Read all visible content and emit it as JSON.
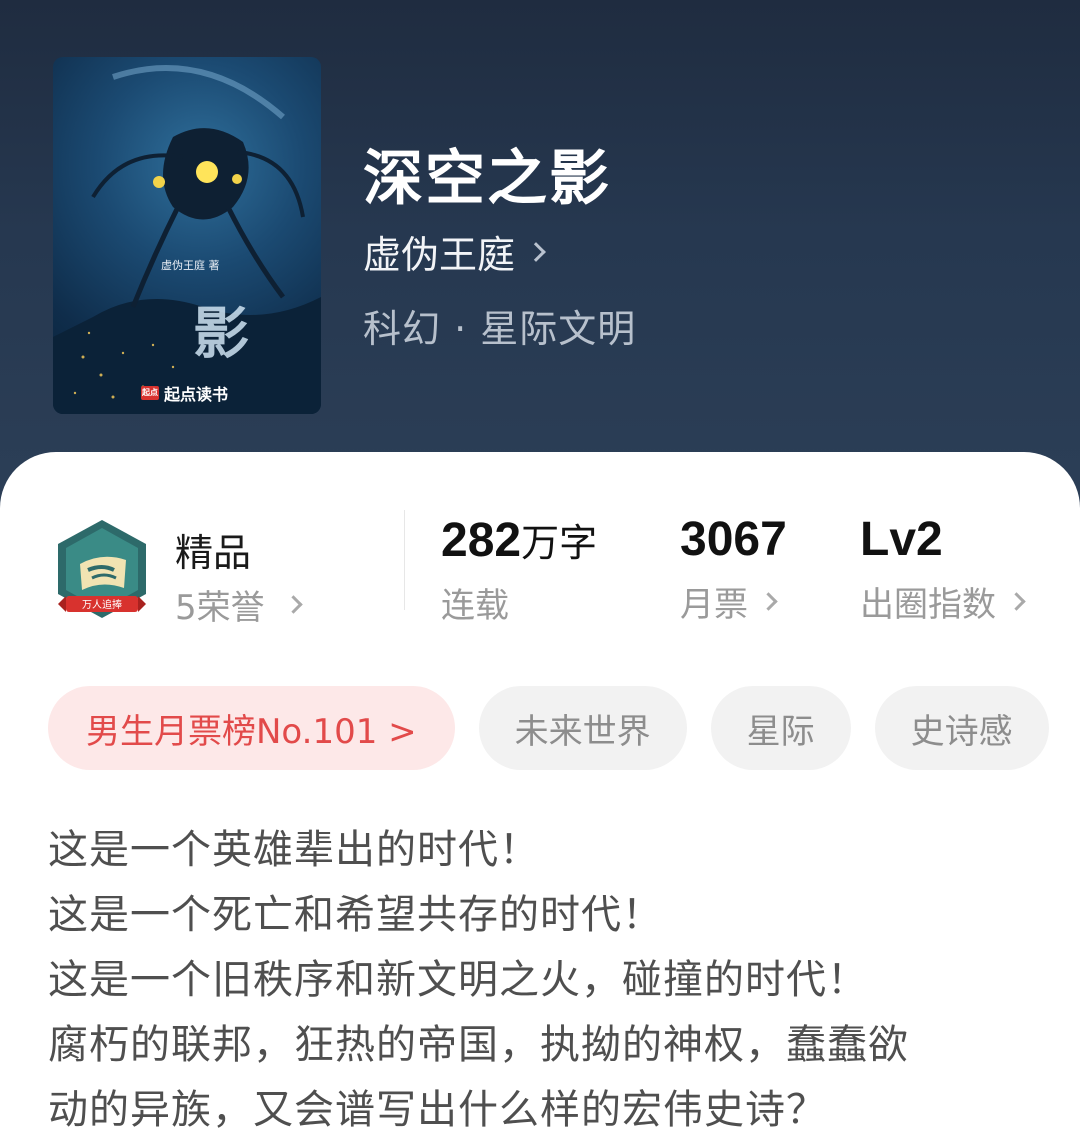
{
  "book": {
    "title": "深空之影",
    "author": "虚伪王庭",
    "genre": "科幻 · 星际文明",
    "cover": {
      "author_text": "虚伪王庭 著",
      "title_text": "影",
      "brand": "起点读书",
      "brand_mark": "起点"
    }
  },
  "honor": {
    "quality": "精品",
    "honors": "5荣誉",
    "badge_text": "万人追捧"
  },
  "stats": [
    {
      "value": "282",
      "unit": "万字",
      "label": "连载"
    },
    {
      "value": "3067",
      "unit": "",
      "label": "月票"
    },
    {
      "value": "Lv2",
      "unit": "",
      "label": "出圈指数"
    }
  ],
  "tags": [
    "男生月票榜No.101 >",
    "未来世界",
    "星际",
    "史诗感"
  ],
  "description": [
    "这是一个英雄辈出的时代！",
    "这是一个死亡和希望共存的时代！",
    "这是一个旧秩序和新文明之火，碰撞的时代！",
    "腐朽的联邦，狂热的帝国，执拗的神权，蠢蠢欲",
    "动的异族，又会谱写出什么样的宏伟史诗？"
  ],
  "colors": {
    "hero_bg": "#263850",
    "rank_tag_bg": "#fde8e8",
    "rank_tag_text": "#e24a4a",
    "tag_bg": "#f2f2f2"
  }
}
